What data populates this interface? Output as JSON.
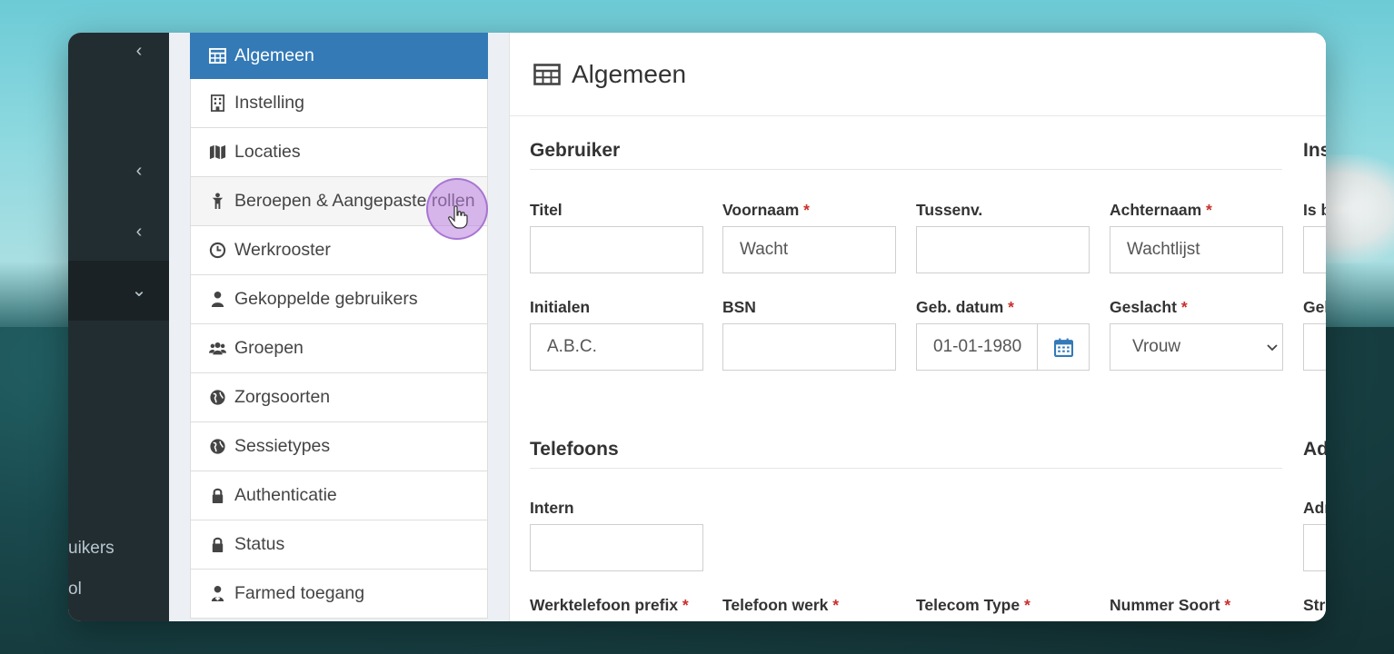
{
  "sidebar": {
    "items": [
      {
        "label": "uikers"
      },
      {
        "label": "ol"
      }
    ]
  },
  "menu": {
    "items": [
      {
        "label": "Algemeen",
        "icon": "table-icon",
        "active": true
      },
      {
        "label": "Instelling",
        "icon": "building-icon"
      },
      {
        "label": "Locaties",
        "icon": "map-icon"
      },
      {
        "label": "Beroepen & Aangepaste rollen",
        "icon": "child-icon"
      },
      {
        "label": "Werkrooster",
        "icon": "clock-icon"
      },
      {
        "label": "Gekoppelde gebruikers",
        "icon": "user-icon"
      },
      {
        "label": "Groepen",
        "icon": "users-icon"
      },
      {
        "label": "Zorgsoorten",
        "icon": "globe-icon"
      },
      {
        "label": "Sessietypes",
        "icon": "globe-icon"
      },
      {
        "label": "Authenticatie",
        "icon": "lock-icon"
      },
      {
        "label": "Status",
        "icon": "lock-icon"
      },
      {
        "label": "Farmed toegang",
        "icon": "user-md-icon"
      }
    ]
  },
  "content": {
    "title": "Algemeen",
    "sections": {
      "gebruiker": "Gebruiker",
      "instelling_partial": "Ins",
      "telefoons": "Telefoons",
      "adres_partial": "Ad"
    },
    "labels": {
      "titel": "Titel",
      "voornaam": "Voornaam",
      "tussenv": "Tussenv.",
      "achternaam": "Achternaam",
      "is_partial": "Is b",
      "initialen": "Initialen",
      "bsn": "BSN",
      "geb_datum": "Geb. datum",
      "geslacht": "Geslacht",
      "gel_partial": "Gel",
      "intern": "Intern",
      "adr_partial": "Adr",
      "werktelefoon_prefix": "Werktelefoon prefix",
      "telefoon_werk": "Telefoon werk",
      "telecom_type": "Telecom Type",
      "nummer_soort": "Nummer Soort",
      "str_partial": "Str"
    },
    "required_mark": "*",
    "values": {
      "titel": "",
      "voornaam": "Wacht",
      "tussenv": "",
      "achternaam": "Wachtlijst",
      "initialen": "A.B.C.",
      "bsn": "",
      "geb_datum": "01-01-1980",
      "geslacht": "Vrouw",
      "intern": ""
    }
  },
  "colors": {
    "active_menu": "#337ab7",
    "sidebar_dark": "#222d32",
    "required": "#c9302c",
    "calendar_icon": "#337ab7"
  }
}
